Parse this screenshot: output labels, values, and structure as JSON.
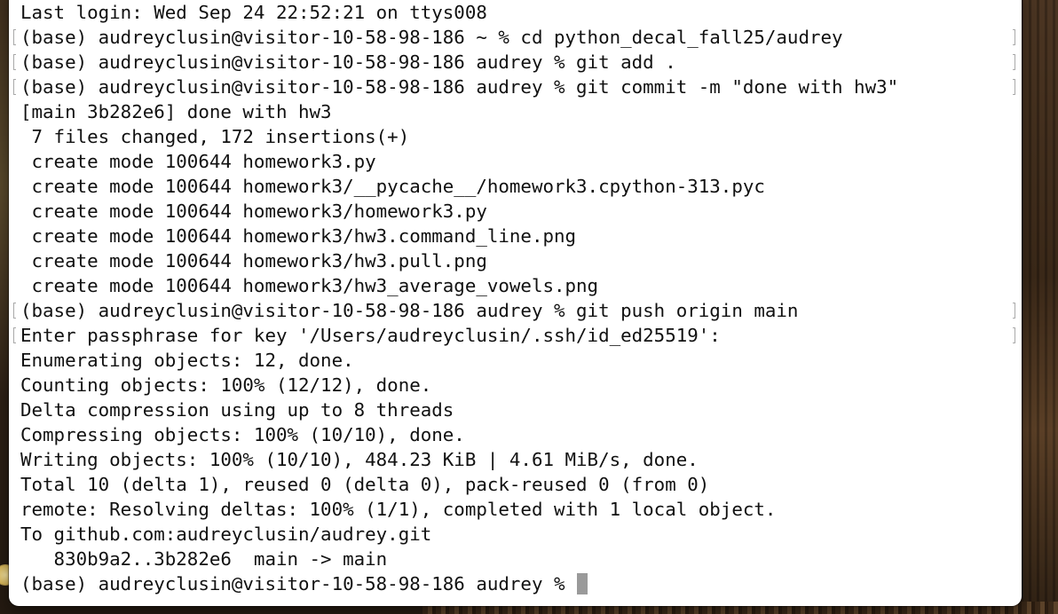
{
  "terminal": {
    "lines": [
      "Last login: Wed Sep 24 22:52:21 on ttys008",
      "(base) audreyclusin@visitor-10-58-98-186 ~ % cd python_decal_fall25/audrey",
      "(base) audreyclusin@visitor-10-58-98-186 audrey % git add .",
      "(base) audreyclusin@visitor-10-58-98-186 audrey % git commit -m \"done with hw3\"",
      "[main 3b282e6] done with hw3",
      " 7 files changed, 172 insertions(+)",
      " create mode 100644 homework3.py",
      " create mode 100644 homework3/__pycache__/homework3.cpython-313.pyc",
      " create mode 100644 homework3/homework3.py",
      " create mode 100644 homework3/hw3.command_line.png",
      " create mode 100644 homework3/hw3.pull.png",
      " create mode 100644 homework3/hw3_average_vowels.png",
      "(base) audreyclusin@visitor-10-58-98-186 audrey % git push origin main",
      "Enter passphrase for key '/Users/audreyclusin/.ssh/id_ed25519':",
      "Enumerating objects: 12, done.",
      "Counting objects: 100% (12/12), done.",
      "Delta compression using up to 8 threads",
      "Compressing objects: 100% (10/10), done.",
      "Writing objects: 100% (10/10), 484.23 KiB | 4.61 MiB/s, done.",
      "Total 10 (delta 1), reused 0 (delta 0), pack-reused 0 (from 0)",
      "remote: Resolving deltas: 100% (1/1), completed with 1 local object.",
      "To github.com:audreyclusin/audrey.git",
      "   830b9a2..3b282e6  main -> main"
    ],
    "prompt": "(base) audreyclusin@visitor-10-58-98-186 audrey % "
  }
}
